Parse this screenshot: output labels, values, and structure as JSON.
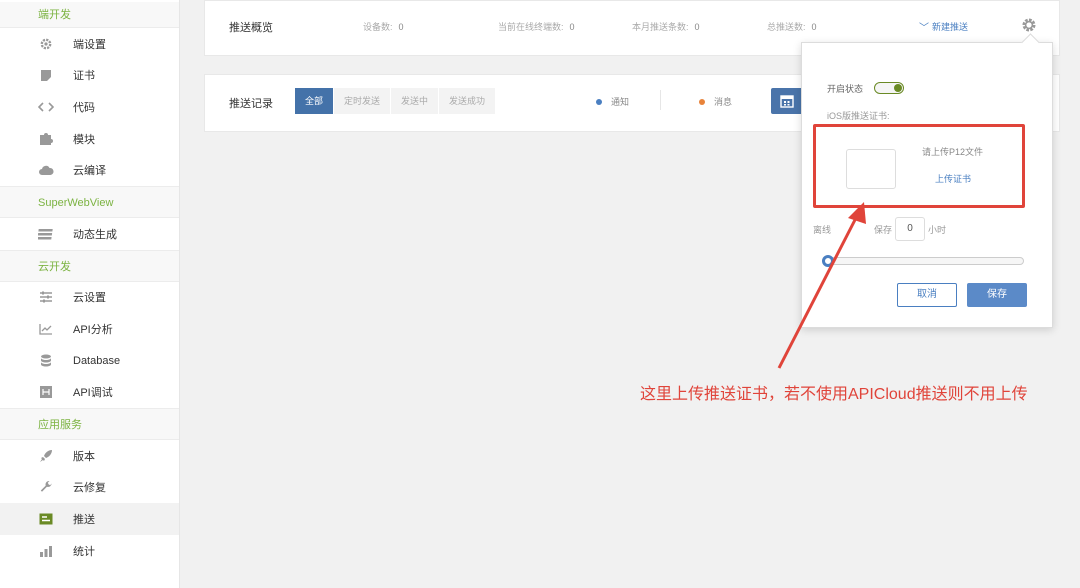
{
  "sidebar": {
    "sections": [
      {
        "title": "端开发",
        "items": [
          {
            "label": "端设置",
            "icon": "gear-icon"
          },
          {
            "label": "证书",
            "icon": "certificate-icon"
          },
          {
            "label": "代码",
            "icon": "code-icon"
          },
          {
            "label": "模块",
            "icon": "puzzle-icon"
          },
          {
            "label": "云编译",
            "icon": "cloud-icon"
          }
        ]
      },
      {
        "title": "SuperWebView",
        "items": [
          {
            "label": "动态生成",
            "icon": "layers-icon"
          }
        ]
      },
      {
        "title": "云开发",
        "items": [
          {
            "label": "云设置",
            "icon": "sliders-icon"
          },
          {
            "label": "API分析",
            "icon": "line-chart-icon"
          },
          {
            "label": "Database",
            "icon": "database-icon"
          },
          {
            "label": "API调试",
            "icon": "debug-icon"
          }
        ]
      },
      {
        "title": "应用服务",
        "items": [
          {
            "label": "版本",
            "icon": "rocket-icon"
          },
          {
            "label": "云修复",
            "icon": "wrench-icon"
          },
          {
            "label": "推送",
            "icon": "push-icon",
            "active": true
          },
          {
            "label": "统计",
            "icon": "bar-chart-icon"
          }
        ]
      }
    ],
    "accent_color": "#7cb342"
  },
  "overview": {
    "title": "推送概览",
    "stats": [
      {
        "label": "设备数:",
        "value": "0"
      },
      {
        "label": "当前在线终端数:",
        "value": "0"
      },
      {
        "label": "本月推送条数:",
        "value": "0"
      },
      {
        "label": "总推送数:",
        "value": "0"
      }
    ],
    "new_push_label": "新建推送"
  },
  "records": {
    "title": "推送记录",
    "filters": [
      "全部",
      "定时发送",
      "发送中",
      "发送成功"
    ],
    "active_filter": "全部",
    "legend": [
      {
        "label": "通知",
        "color": "#4a7fc1"
      },
      {
        "label": "消息",
        "color": "#e8833a"
      }
    ]
  },
  "popup": {
    "status_label": "开启状态",
    "status_on": true,
    "ios_cert_label": "iOS版推送证书:",
    "upload_hint": "请上传P12文件",
    "upload_link": "上传证书",
    "offline_label": "离线",
    "offline_keep": "保存",
    "hours_value": "0",
    "hours_unit": "小时",
    "slider_value": 0,
    "cancel_label": "取消",
    "save_label": "保存"
  },
  "annotation": {
    "text": "这里上传推送证书，若不使用APICloud推送则不用上传",
    "color": "#e0443a"
  }
}
